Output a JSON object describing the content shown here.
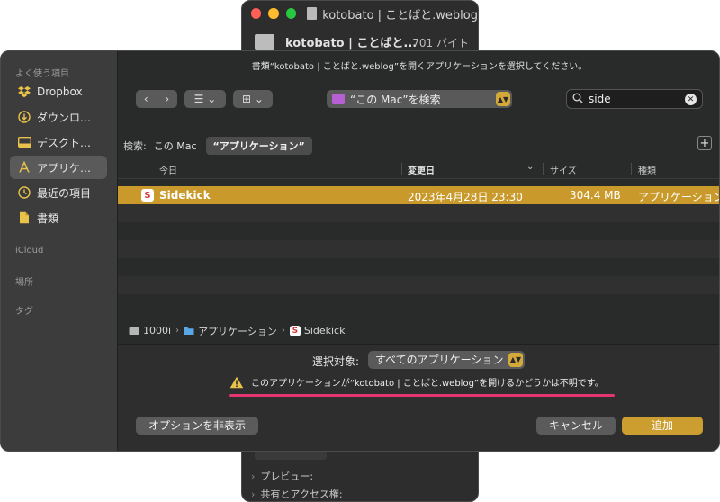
{
  "background_window": {
    "title": "kotobato | ことばと.weblog",
    "file_name": "kotobato | ことばと...",
    "file_size": "701 バイト",
    "sections": [
      {
        "label": "プレビュー:"
      },
      {
        "label": "共有とアクセス権:"
      }
    ]
  },
  "dialog": {
    "prompt": "書類“kotobato | ことばと.weblog”を開くアプリケーションを選択してください。",
    "sidebar": {
      "favorites_heading": "よく使う項目",
      "items": [
        {
          "label": "Dropbox",
          "icon": "dropbox-icon"
        },
        {
          "label": "ダウンロ…",
          "icon": "download-icon"
        },
        {
          "label": "デスクト…",
          "icon": "desktop-icon"
        },
        {
          "label": "アプリケ…",
          "icon": "applications-icon",
          "selected": true
        },
        {
          "label": "最近の項目",
          "icon": "clock-icon"
        },
        {
          "label": "書類",
          "icon": "document-icon"
        }
      ],
      "icloud_heading": "iCloud",
      "locations_heading": "場所",
      "tags_heading": "タグ"
    },
    "toolbar": {
      "back": "‹",
      "forward": "›",
      "view_list": "☰ ⌄",
      "view_grid": "⊞ ⌄",
      "location": "“この Mac”を検索"
    },
    "search": {
      "value": "side"
    },
    "scope": {
      "label": "検索:",
      "this_mac": "この Mac",
      "applications": "“アプリケーション”"
    },
    "columns": {
      "name": "今日",
      "date": "変更日",
      "size": "サイズ",
      "kind": "種類"
    },
    "files": [
      {
        "name": "Sidekick",
        "date": "2023年4月28日 23:30",
        "size": "304.4 MB",
        "kind": "アプリケーション"
      }
    ],
    "path": [
      {
        "label": "1000i"
      },
      {
        "label": "アプリケーション"
      },
      {
        "label": "Sidekick"
      }
    ],
    "enable": {
      "label": "選択対象:",
      "value": "すべてのアプリケーション"
    },
    "warning": "このアプリケーションが“kotobato | ことばと.weblog”を開けるかどうかは不明です。",
    "buttons": {
      "options": "オプションを非表示",
      "cancel": "キャンセル",
      "add": "追加"
    },
    "colors": {
      "accent": "#c99a2b",
      "highlight_underline": "#e4356f"
    }
  }
}
